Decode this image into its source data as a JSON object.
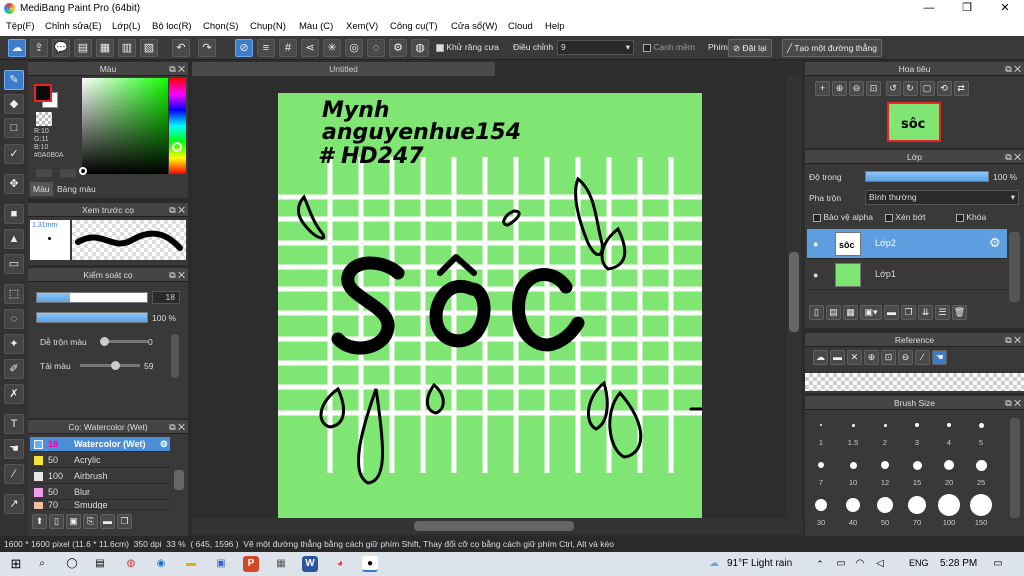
{
  "window": {
    "title": "MediBang Paint Pro (64bit)",
    "min": "—",
    "max": "❐",
    "close": "✕"
  },
  "menu": [
    "Tệp(F)",
    "Chỉnh sửa(E)",
    "Lớp(L)",
    "Bộ lọc(R)",
    "Chọn(S)",
    "Chụp(N)",
    "Màu (C)",
    "Xem(V)",
    "Công cụ(T)",
    "Cửa sổ(W)",
    "Cloud",
    "Help"
  ],
  "toolbar": {
    "antialias_label": "Khử răng cưa",
    "antialias_checked": true,
    "adjust_label": "Điều chỉnh",
    "adjust_value": "9",
    "edge_label": "Cạnh mềm",
    "key_label": "Phím",
    "reset_label": "Đặt lại",
    "straight_line_label": "Tạo một đường thẳng"
  },
  "color_panel": {
    "title": "Màu",
    "fg_color": "#0A0B0A",
    "r": "R:10",
    "g": "G:11",
    "b": "B:10",
    "hex": "#0A0B0A",
    "tab_color": "Màu",
    "tab_palette": "Bảng màu"
  },
  "brush_preview": {
    "title": "Xem trước cọ",
    "size": "1.31mm"
  },
  "brush_control": {
    "title": "Kiểm soát cọ",
    "size_value": "18",
    "size_fill": 0.3,
    "opacity_value": "100 %",
    "opacity_fill": 1.0,
    "blend_label": "Dễ trộn màu",
    "blend_value": "0",
    "blend_fill": 0.0,
    "mix_label": "Tải màu",
    "mix_value": "59",
    "mix_fill": 0.59
  },
  "brush_list": {
    "title": "Cọ: Watercolor (Wet)",
    "items": [
      {
        "size": "18",
        "name": "Watercolor (Wet)",
        "color": "#5fb4f2",
        "selected": true
      },
      {
        "size": "50",
        "name": "Acrylic",
        "color": "#f5e23a",
        "selected": false
      },
      {
        "size": "100",
        "name": "Airbrush",
        "color": "#e8e8e8",
        "selected": false
      },
      {
        "size": "50",
        "name": "Blur",
        "color": "#f19cf0",
        "selected": false
      },
      {
        "size": "70",
        "name": "Smudge",
        "color": "#f0c0a0",
        "selected": false
      }
    ]
  },
  "document": {
    "tab": "Untitled",
    "handwriting": [
      "Mynh",
      "anguyenhue154",
      "# HD247"
    ],
    "main_word": "sôc",
    "paper_color": "#7fe573"
  },
  "navigator": {
    "title": "Hoa tiêu"
  },
  "layers": {
    "title": "Lớp",
    "opacity_label": "Độ trong",
    "opacity_value": "100 %",
    "opacity_fill": 1.0,
    "blend_label": "Pha trộn",
    "blend_value": "Bình thường",
    "protect_alpha": "Bảo vệ alpha",
    "clipping": "Xén bớt",
    "lock": "Khóa",
    "items": [
      {
        "name": "Lớp2",
        "selected": true
      },
      {
        "name": "Lớp1",
        "selected": false
      }
    ]
  },
  "reference": {
    "title": "Reference"
  },
  "brush_size": {
    "title": "Brush Size",
    "values": [
      "1",
      "1.5",
      "2",
      "3",
      "4",
      "5",
      "7",
      "10",
      "12",
      "15",
      "20",
      "25",
      "30",
      "40",
      "50",
      "70",
      "100",
      "150"
    ]
  },
  "status": {
    "doc_size": "1600 * 1600 pixel",
    "doc_size_cm": "(11.6 * 11.6cm)",
    "dpi": "350 dpi",
    "zoom": "33 %",
    "cursor": "( 645, 1596 )",
    "hint": "Vẽ một đường thẳng bằng cách giữ phím Shift, Thay đổi cỡ cọ bằng cách giữ phím Ctrl, Alt và kéo"
  },
  "taskbar": {
    "weather": "91°F  Light rain",
    "lang": "ENG",
    "time": "5:28 PM"
  }
}
